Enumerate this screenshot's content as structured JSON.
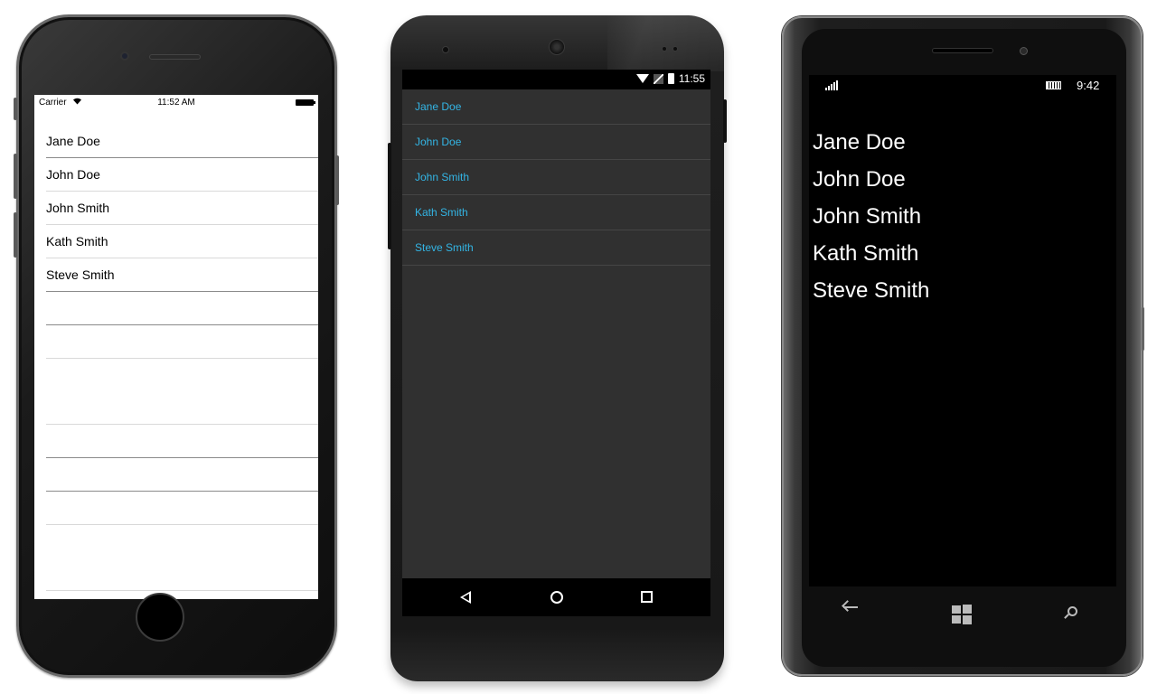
{
  "ios": {
    "status": {
      "carrier": "Carrier",
      "time": "11:52 AM"
    },
    "items": [
      "Jane Doe",
      "John Doe",
      "John Smith",
      "Kath Smith",
      "Steve Smith"
    ]
  },
  "android": {
    "status": {
      "time": "11:55"
    },
    "items": [
      "Jane Doe",
      "John Doe",
      "John Smith",
      "Kath Smith",
      "Steve Smith"
    ],
    "accent_color": "#33b5e5",
    "background_color": "#303030"
  },
  "windows_phone": {
    "status": {
      "time": "9:42"
    },
    "items": [
      "Jane Doe",
      "John Doe",
      "John Smith",
      "Kath Smith",
      "Steve Smith"
    ]
  }
}
